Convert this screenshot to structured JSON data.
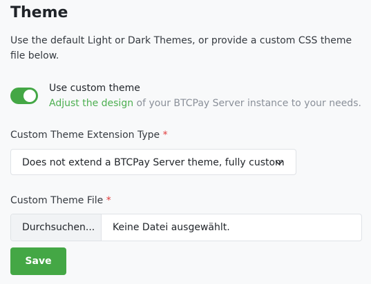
{
  "page": {
    "title": "Theme",
    "description": "Use the default Light or Dark Themes, or provide a custom CSS theme file below."
  },
  "toggle": {
    "label": "Use custom theme",
    "state": "on",
    "help_link": "Adjust the design",
    "help_rest": " of your BTCPay Server instance to your needs."
  },
  "extension_type": {
    "label": "Custom Theme Extension Type",
    "required_mark": "*",
    "selected": "Does not extend a BTCPay Server theme, fully custom"
  },
  "theme_file": {
    "label": "Custom Theme File",
    "required_mark": "*",
    "browse_label": "Durchsuchen...",
    "file_status": "Keine Datei ausgewählt."
  },
  "actions": {
    "save_label": "Save"
  },
  "colors": {
    "accent": "#44a745",
    "link": "#4caf50",
    "required": "#e03a3a",
    "background": "#f8f9fa"
  },
  "icons": {
    "select_chevron": "chevron-down-icon"
  }
}
